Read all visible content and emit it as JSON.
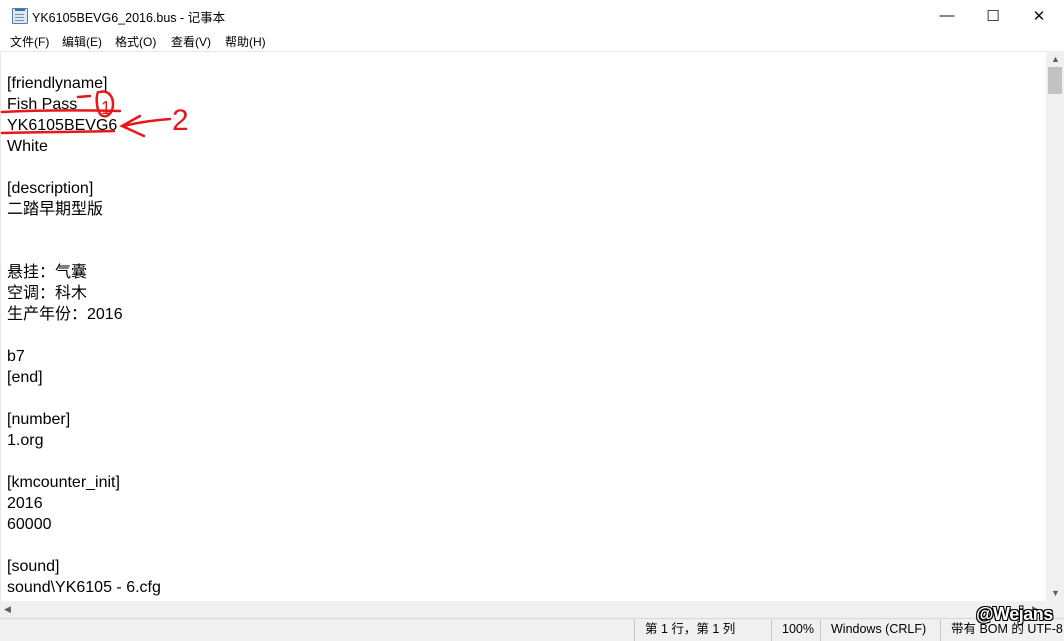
{
  "window": {
    "title": "YK6105BEVG6_2016.bus - 记事本",
    "minimize_glyph": "—",
    "maximize_glyph": "☐",
    "close_glyph": "✕",
    "icon": "notepad-icon"
  },
  "menu": {
    "items": [
      "文件(F)",
      "编辑(E)",
      "格式(O)",
      "查看(V)",
      "帮助(H)"
    ]
  },
  "editor": {
    "lines": [
      "[friendlyname]",
      "Fish Pass",
      "YK6105BEVG6",
      "White",
      "",
      "[description]",
      "二踏早期型版",
      "",
      "",
      "悬挂：气囊",
      "空调：科木",
      "生产年份：2016",
      "",
      "b7",
      "[end]",
      "",
      "[number]",
      "1.org",
      "",
      "[kmcounter_init]",
      "2016",
      "60000",
      "",
      "[sound]",
      "sound\\YK6105 - 6.cfg"
    ]
  },
  "annotations": {
    "label_1": "1",
    "label_2": "2",
    "color": "#e8161a"
  },
  "statusbar": {
    "position": "第 1 行，第 1 列",
    "zoom": "100%",
    "line_ending": "Windows (CRLF)",
    "encoding": "带有 BOM 的 UTF-8"
  },
  "watermark": "@Wejans"
}
